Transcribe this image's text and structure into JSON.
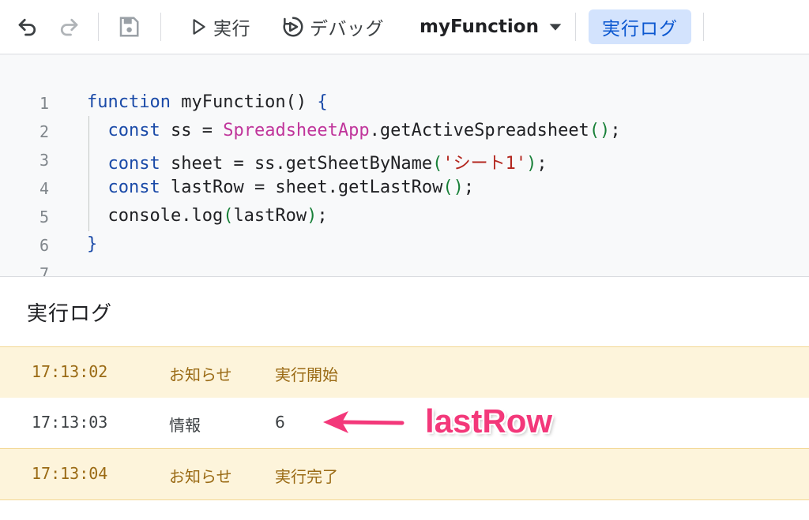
{
  "toolbar": {
    "run_label": "実行",
    "debug_label": "デバッグ",
    "function_name": "myFunction",
    "log_label": "実行ログ"
  },
  "editor": {
    "line_numbers": [
      "1",
      "2",
      "3",
      "4",
      "5",
      "6",
      "7"
    ]
  },
  "log_panel": {
    "title": "実行ログ",
    "rows": [
      {
        "time": "17:13:02",
        "level": "お知らせ",
        "message": "実行開始"
      },
      {
        "time": "17:13:03",
        "level": "情報",
        "message": "6"
      },
      {
        "time": "17:13:04",
        "level": "お知らせ",
        "message": "実行完了"
      }
    ]
  },
  "annotation": {
    "text": "lastRow",
    "color": "#f3387a"
  },
  "colors": {
    "keyword": "#1a4aa8",
    "class_name": "#c0359b",
    "string": "#b3261e",
    "parens": "#188038",
    "notice_row_bg": "#fdf4db",
    "active_toggle_bg": "#d3e3fd"
  }
}
